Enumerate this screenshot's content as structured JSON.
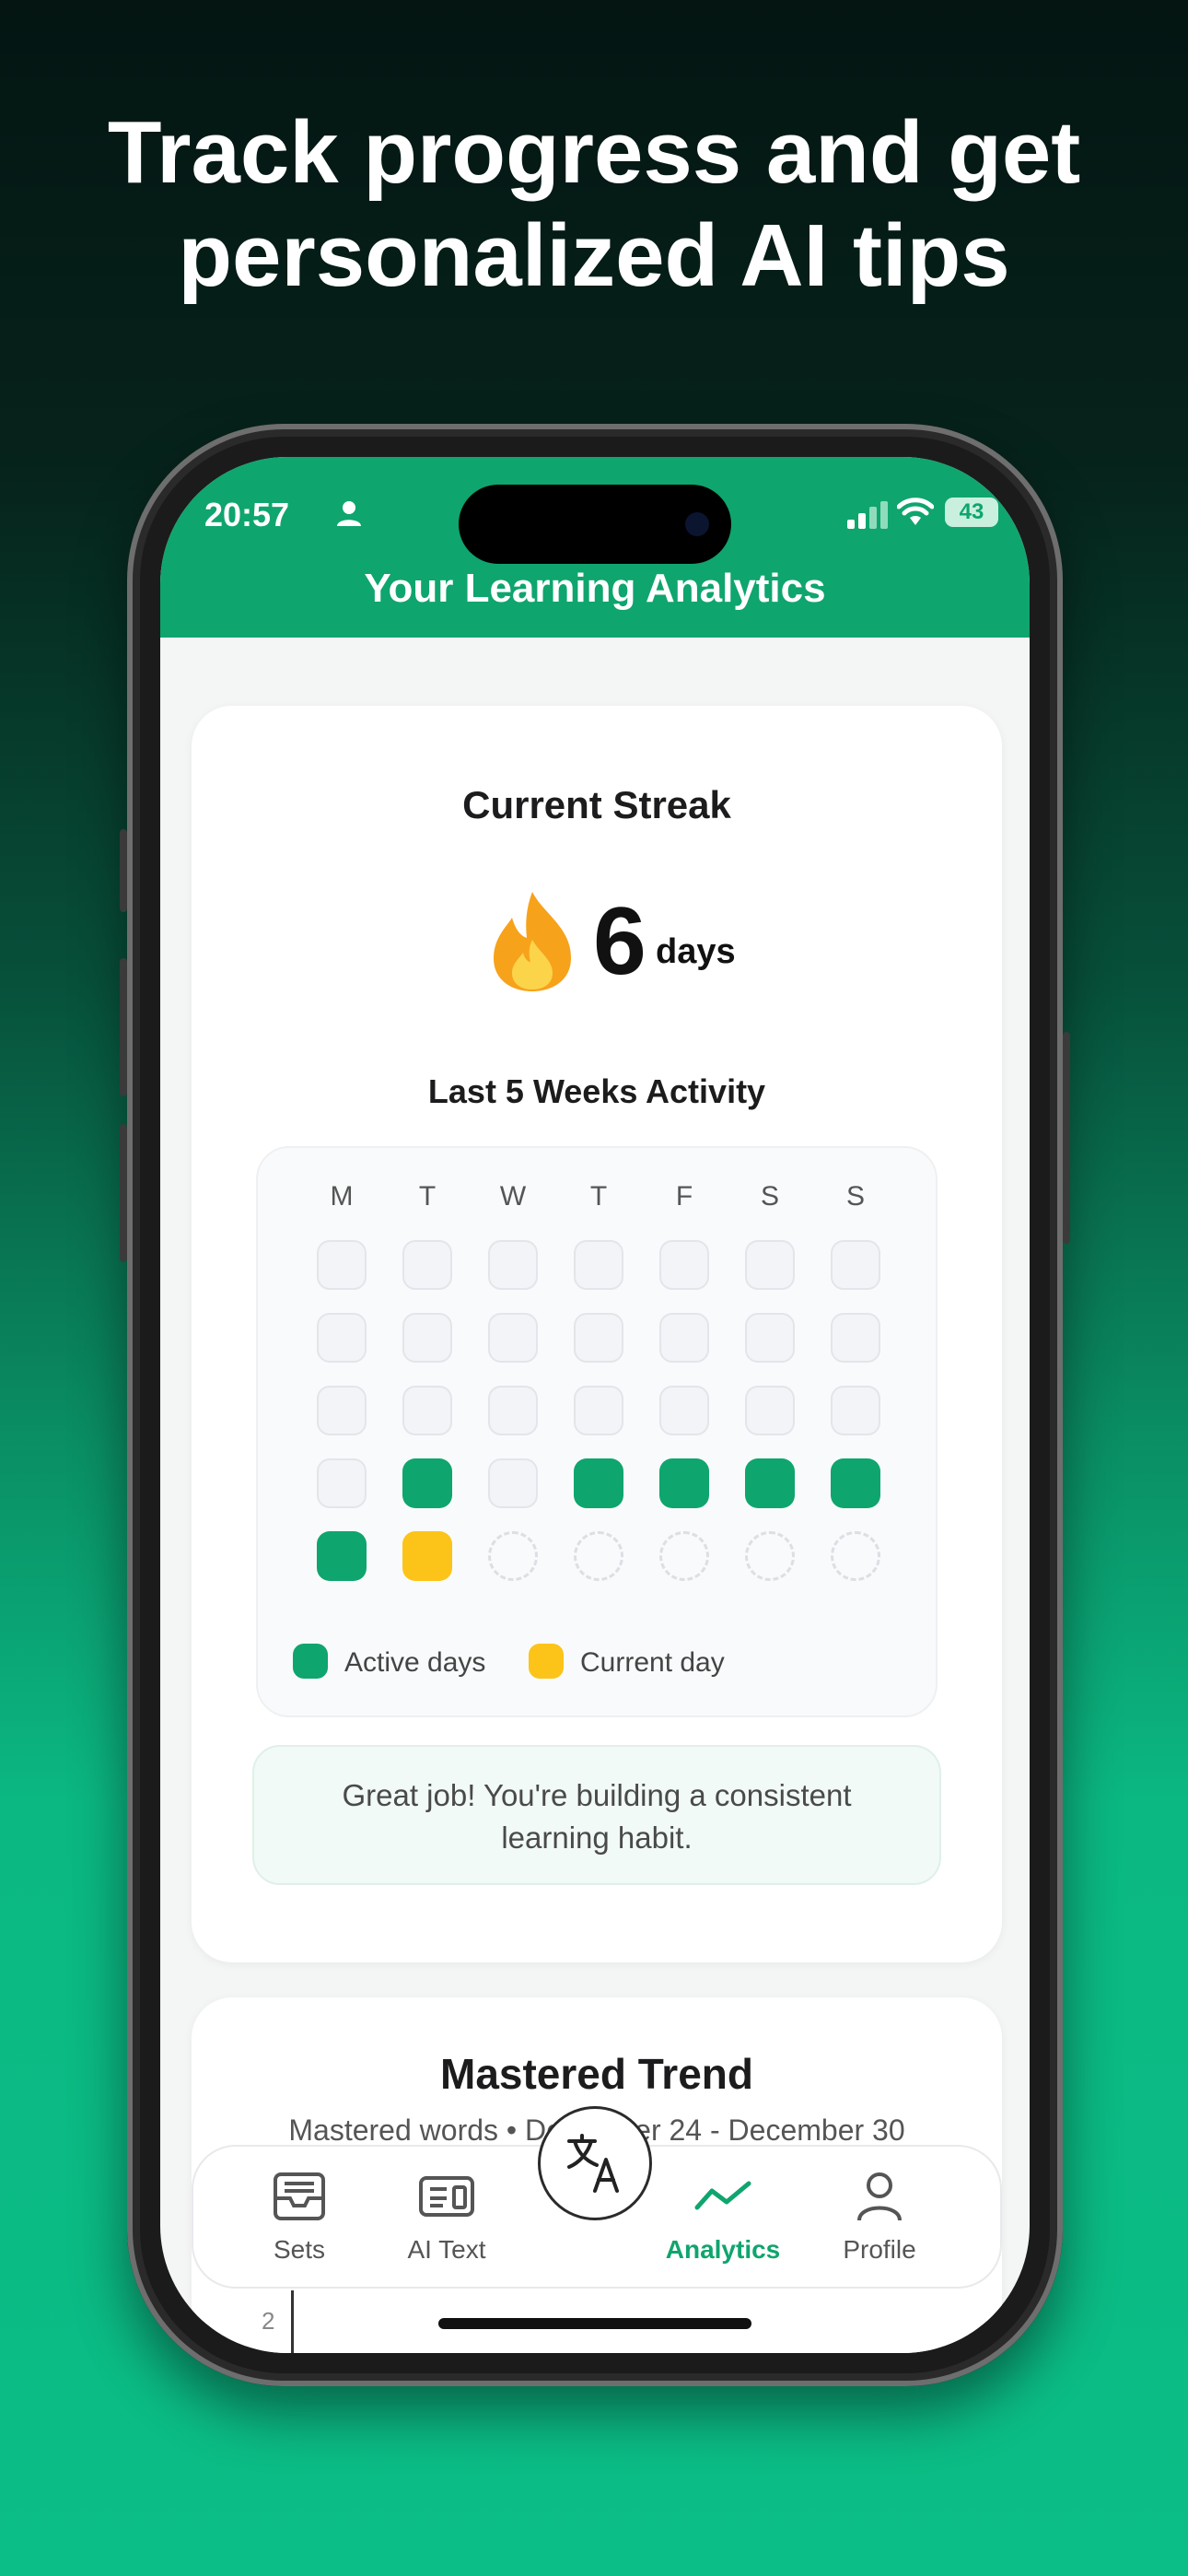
{
  "headline": {
    "line1": "Track progress and get",
    "line2": "personalized AI tips"
  },
  "status_bar": {
    "time": "20:57",
    "battery": "43"
  },
  "app_bar": {
    "title": "Your Learning Analytics"
  },
  "streak_card": {
    "title": "Current Streak",
    "value": "6",
    "unit": "days",
    "activity_title": "Last 5 Weeks Activity",
    "day_headers": [
      "M",
      "T",
      "W",
      "T",
      "F",
      "S",
      "S"
    ],
    "weeks": [
      [
        "empty",
        "empty",
        "empty",
        "empty",
        "empty",
        "empty",
        "empty"
      ],
      [
        "empty",
        "empty",
        "empty",
        "empty",
        "empty",
        "empty",
        "empty"
      ],
      [
        "empty",
        "empty",
        "empty",
        "empty",
        "empty",
        "empty",
        "empty"
      ],
      [
        "empty",
        "active",
        "empty",
        "active",
        "active",
        "active",
        "active"
      ],
      [
        "active",
        "current",
        "future",
        "future",
        "future",
        "future",
        "future"
      ]
    ],
    "legend": {
      "active": "Active days",
      "current": "Current day"
    },
    "message_line1": "Great job! You're building a consistent",
    "message_line2": "learning habit."
  },
  "trend_card": {
    "title": "Mastered Trend",
    "subtitle": "Mastered words • December 24 - December 30",
    "axis_value": "2"
  },
  "tab_bar": {
    "tabs": [
      {
        "label": "Sets",
        "icon": "inbox-tray-icon"
      },
      {
        "label": "AI Text",
        "icon": "text-document-icon"
      },
      {
        "label": "Analytics",
        "icon": "trend-line-icon",
        "active": true
      },
      {
        "label": "Profile",
        "icon": "person-icon"
      }
    ],
    "center_button_icon": "translate-icon"
  },
  "colors": {
    "brand": "#0fa56e",
    "current_day": "#fcc419"
  }
}
